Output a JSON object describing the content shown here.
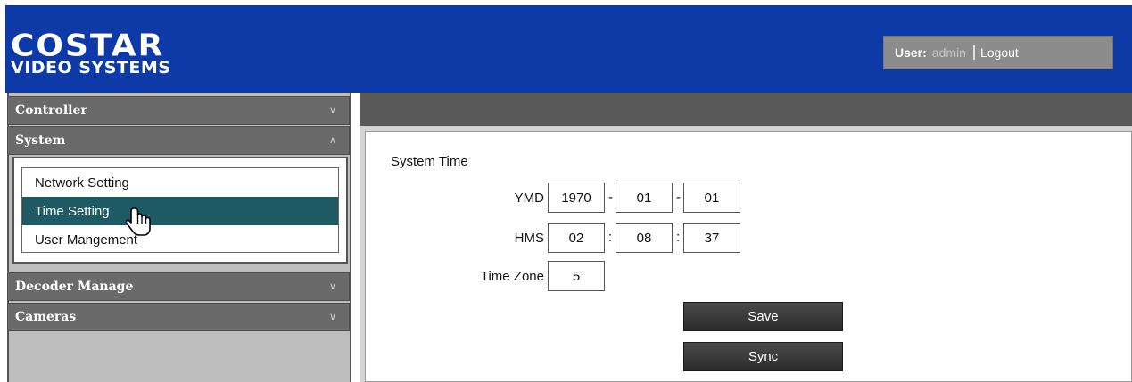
{
  "header": {
    "logo_main": "COSTAR",
    "logo_sub": "VIDEO SYSTEMS",
    "user_label": "User:",
    "username": "admin",
    "logout_label": "Logout"
  },
  "sidebar": {
    "sections": [
      {
        "label": "Controller",
        "chevron": "chevron-down-icon"
      },
      {
        "label": "System",
        "chevron": "chevron-up-icon"
      },
      {
        "label": "Decoder Manage",
        "chevron": "chevron-down-icon"
      },
      {
        "label": "Cameras",
        "chevron": "chevron-down-icon"
      }
    ],
    "system_items": [
      {
        "label": "Network Setting"
      },
      {
        "label": "Time Setting",
        "active": true
      },
      {
        "label": "User Mangement"
      }
    ]
  },
  "main": {
    "section_title": "System Time",
    "ymd_label": "YMD",
    "ymd": {
      "year": "1970",
      "month": "01",
      "day": "01"
    },
    "hms_label": "HMS",
    "hms": {
      "hour": "02",
      "minute": "08",
      "second": "37"
    },
    "date_separator": "-",
    "time_separator": ":",
    "timezone_label": "Time Zone",
    "timezone": "5",
    "save_label": "Save",
    "sync_label": "Sync"
  },
  "colors": {
    "header_bg": "#0e3aa8",
    "active_item_bg": "#1d5a63",
    "accordion_bg": "#6a6a6a",
    "button_bg": "#2c2c2c"
  }
}
